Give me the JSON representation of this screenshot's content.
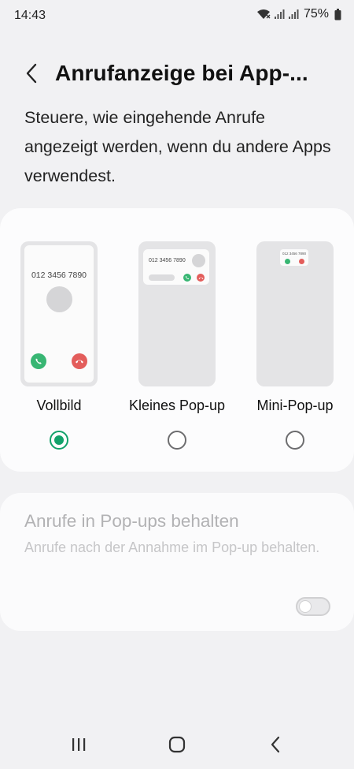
{
  "status_bar": {
    "time": "14:43",
    "battery": "75%",
    "icons": [
      "wifi-icon",
      "signal-icon",
      "signal-icon",
      "battery-icon"
    ]
  },
  "header": {
    "back_icon": "back-arrow-icon",
    "title": "Anrufanzeige bei App-..."
  },
  "description": "Steuere, wie eingehende Anrufe angezeigt werden, wenn du andere Apps verwendest.",
  "options": [
    {
      "label": "Vollbild",
      "selected": true,
      "preview_number": "012 3456 7890"
    },
    {
      "label": "Kleines Pop-up",
      "selected": false,
      "preview_number": "012 3456 7890"
    },
    {
      "label": "Mini-Pop-up",
      "selected": false,
      "preview_number": "012 3456 7890"
    }
  ],
  "keep_in_popups": {
    "title": "Anrufe in Pop-ups behalten",
    "description": "Anrufe nach der Annahme im Pop-up behalten.",
    "enabled": false,
    "disabled_appearance": true
  },
  "nav_bar": {
    "icons": [
      "recent-apps-icon",
      "home-icon",
      "back-icon"
    ]
  },
  "colors": {
    "accent": "#12a26b",
    "accept": "#38b673",
    "decline": "#e35d5b",
    "background": "#f1f1f3",
    "card": "#fcfcfd"
  }
}
